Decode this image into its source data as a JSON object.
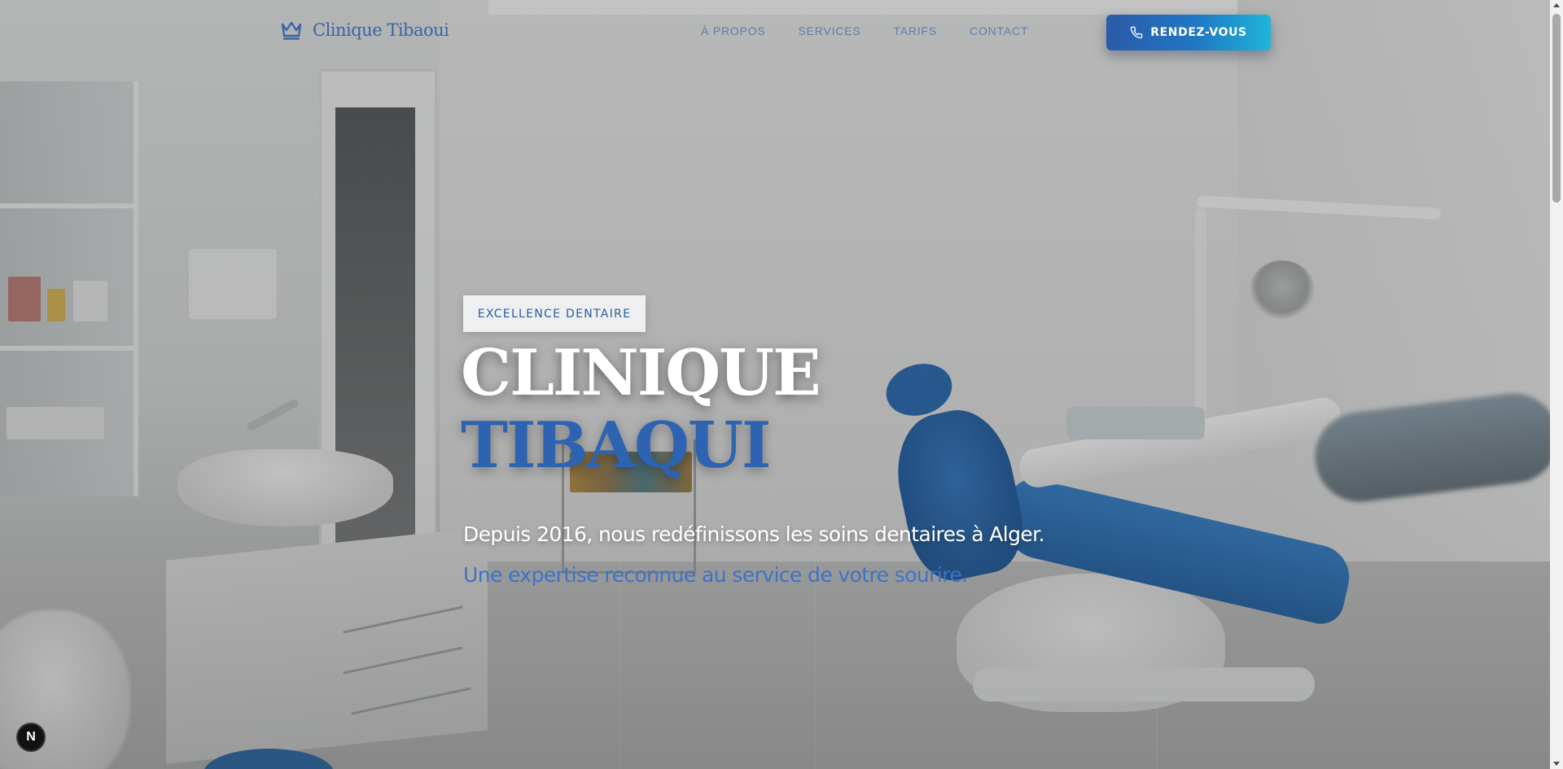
{
  "header": {
    "logo_text": "Clinique Tibaoui",
    "logo_icon": "crown-icon",
    "nav": [
      {
        "label": "À PROPOS"
      },
      {
        "label": "SERVICES"
      },
      {
        "label": "TARIFS"
      },
      {
        "label": "CONTACT"
      }
    ],
    "cta_label": "RENDEZ-VOUS",
    "cta_icon": "phone-icon"
  },
  "hero": {
    "badge": "EXCELLENCE DENTAIRE",
    "title_line1": "CLINIQUE",
    "title_line2": "TIBAQUI",
    "subtitle": "Depuis 2016, nous redéfinissons les soins dentaires à Alger.",
    "tagline": "Une expertise reconnue au service de votre sourire."
  },
  "dev_badge": {
    "label": "N"
  },
  "colors": {
    "accent_blue": "#2d63b0",
    "cta_gradient_start": "#2c5aa8",
    "cta_gradient_end": "#1fb5d8",
    "badge_bg": "#eeeff0"
  }
}
